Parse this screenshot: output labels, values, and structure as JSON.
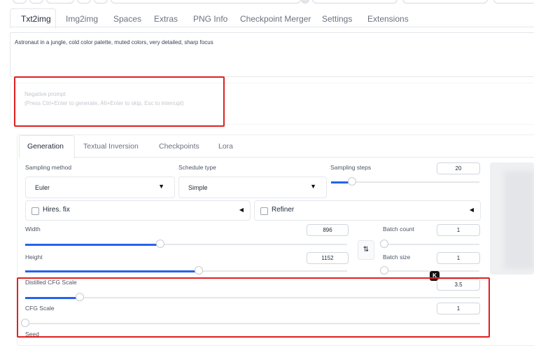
{
  "top_tabs": [
    {
      "label": "Txt2img",
      "active": true
    },
    {
      "label": "Img2img"
    },
    {
      "label": "Spaces"
    },
    {
      "label": "Extras"
    },
    {
      "label": "PNG Info"
    },
    {
      "label": "Checkpoint Merger"
    },
    {
      "label": "Settings"
    },
    {
      "label": "Extensions"
    }
  ],
  "prompt": {
    "value": "Astronaut in a jungle, cold color palette, muted colors, very detailed, sharp focus"
  },
  "negative_prompt": {
    "placeholder_line1": "Negative prompt",
    "placeholder_line2": "(Press Ctrl+Enter to generate, Alt+Enter to skip, Esc to interrupt)"
  },
  "sub_tabs": [
    {
      "label": "Generation",
      "active": true
    },
    {
      "label": "Textual Inversion"
    },
    {
      "label": "Checkpoints"
    },
    {
      "label": "Lora"
    }
  ],
  "sampling_method": {
    "label": "Sampling method",
    "value": "Euler"
  },
  "schedule_type": {
    "label": "Schedule type",
    "value": "Simple"
  },
  "sampling_steps": {
    "label": "Sampling steps",
    "value": "20",
    "fraction": 0.14
  },
  "hires_fix": {
    "label": "Hires. fix",
    "checked": false
  },
  "refiner": {
    "label": "Refiner",
    "checked": false
  },
  "width": {
    "label": "Width",
    "value": "896",
    "fraction": 0.42
  },
  "height": {
    "label": "Height",
    "value": "1152",
    "fraction": 0.54
  },
  "swap_icon": "swap-dimensions-icon",
  "batch_count": {
    "label": "Batch count",
    "value": "1",
    "fraction": 0.0
  },
  "batch_size": {
    "label": "Batch size",
    "value": "1",
    "fraction": 0.0
  },
  "distilled_cfg_scale": {
    "label": "Distilled CFG Scale",
    "value": "3.5",
    "fraction": 0.12
  },
  "cfg_scale": {
    "label": "CFG Scale",
    "value": "1",
    "fraction": 0.0
  },
  "seed": {
    "label": "Seed"
  },
  "badge": {
    "glyph": "K"
  },
  "colors": {
    "accent": "#2563eb",
    "highlight": "#e02020"
  }
}
